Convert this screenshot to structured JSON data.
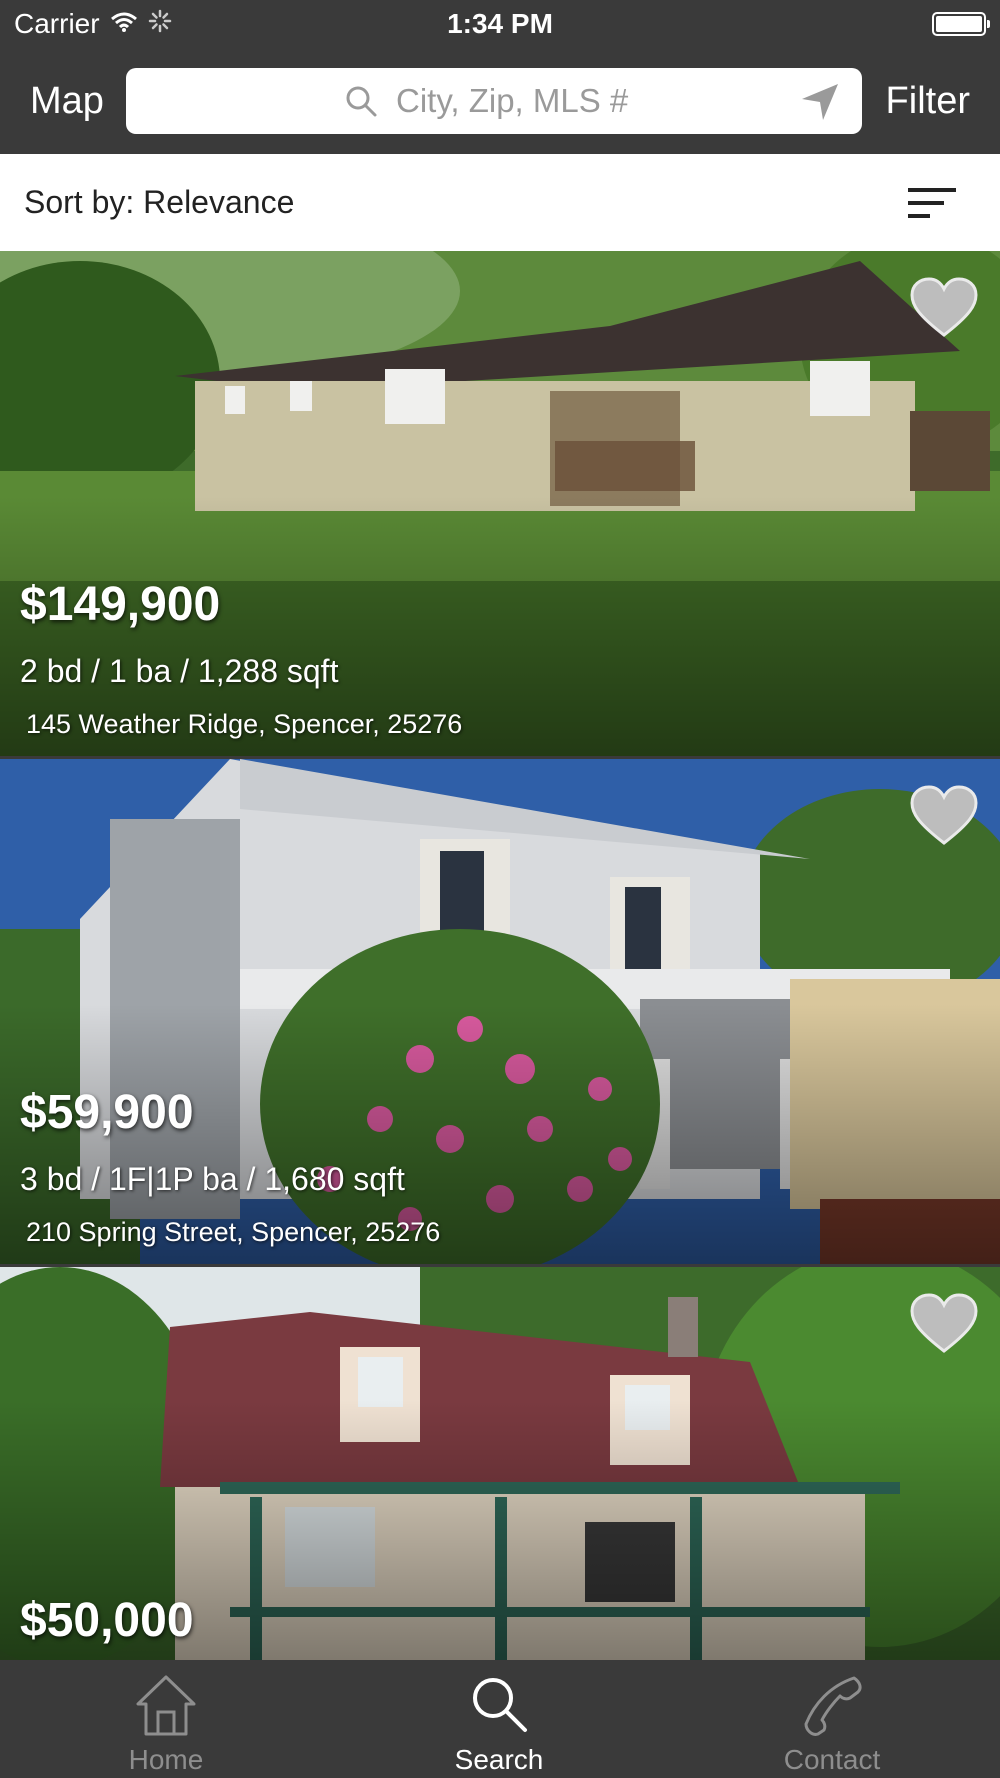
{
  "status_bar": {
    "carrier": "Carrier",
    "time": "1:34 PM"
  },
  "nav": {
    "map_label": "Map",
    "filter_label": "Filter",
    "search_placeholder": "City, Zip, MLS #"
  },
  "sort": {
    "label": "Sort by: Relevance"
  },
  "listings": [
    {
      "price": "$149,900",
      "specs": "2 bd / 1 ba / 1,288 sqft",
      "address": "145 Weather Ridge, Spencer, 25276"
    },
    {
      "price": "$59,900",
      "specs": "3 bd / 1F|1P ba / 1,680 sqft",
      "address": "210 Spring Street, Spencer, 25276"
    },
    {
      "price": "$50,000",
      "specs": "",
      "address": ""
    }
  ],
  "tabs": [
    {
      "label": "Home",
      "icon": "house-icon",
      "active": false
    },
    {
      "label": "Search",
      "icon": "magnifier-icon",
      "active": true
    },
    {
      "label": "Contact",
      "icon": "phone-icon",
      "active": false
    }
  ],
  "colors": {
    "bar_background": "#3a3a3a",
    "tab_active": "#ffffff",
    "tab_inactive": "#8e8e8e"
  }
}
